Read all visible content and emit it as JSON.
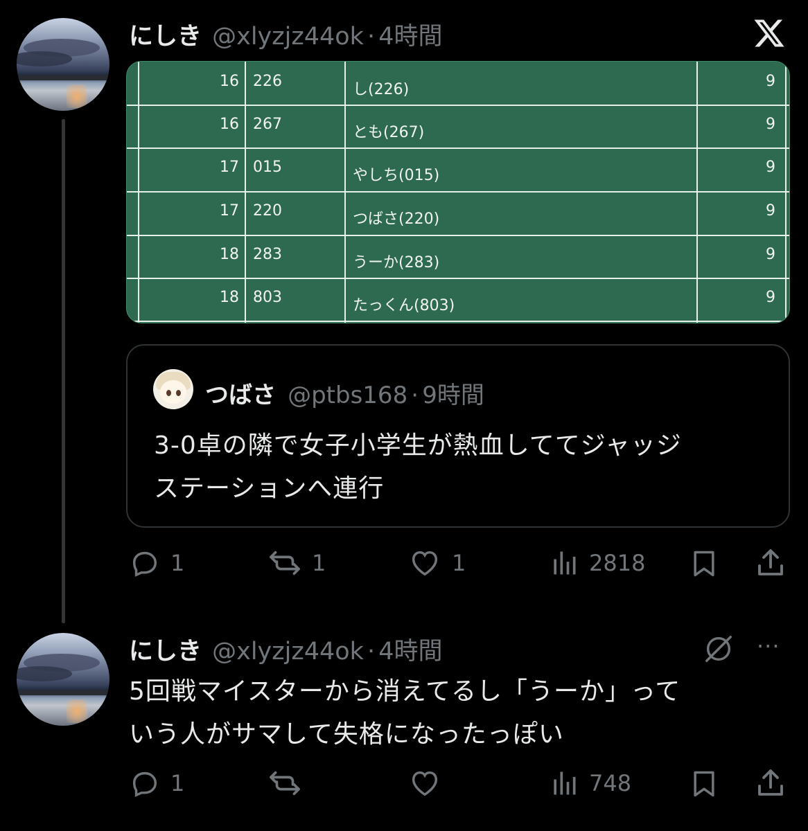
{
  "post1": {
    "display_name": "にしき",
    "handle": "@xlyzjz44ok",
    "separator": "·",
    "time": "4時間",
    "table": {
      "rows": [
        {
          "rank": "16",
          "id": "226",
          "name": "し(226)",
          "score": "9"
        },
        {
          "rank": "16",
          "id": "267",
          "name": "とも(267)",
          "score": "9"
        },
        {
          "rank": "17",
          "id": "015",
          "name": "やしち(015)",
          "score": "9"
        },
        {
          "rank": "17",
          "id": "220",
          "name": "つばさ(220)",
          "score": "9"
        },
        {
          "rank": "18",
          "id": "283",
          "name": "うーか(283)",
          "score": "9"
        },
        {
          "rank": "18",
          "id": "803",
          "name": "たっくん(803)",
          "score": "9"
        }
      ]
    },
    "quote": {
      "display_name": "つばさ",
      "handle": "@ptbs168",
      "separator": "·",
      "time": "9時間",
      "text_line1": "3-0卓の隣で女子小学生が熱血しててジャッジ",
      "text_line2": "ステーションへ連行"
    },
    "actions": {
      "replies": "1",
      "reposts": "1",
      "likes": "1",
      "views": "2818"
    }
  },
  "post2": {
    "display_name": "にしき",
    "handle": "@xlyzjz44ok",
    "separator": "·",
    "time": "4時間",
    "text_line1": "5回戦マイスターから消えてるし「うーか」って",
    "text_line2": "いう人がサマして失格になったっぽい",
    "actions": {
      "replies": "1",
      "views": "748"
    },
    "more": "···"
  },
  "icons": {
    "x_logo": "x-logo-icon",
    "reply": "reply-icon",
    "repost": "repost-icon",
    "like": "heart-icon",
    "views": "views-icon",
    "bookmark": "bookmark-icon",
    "share": "share-icon",
    "grok": "grok-icon"
  },
  "colors": {
    "background": "#000000",
    "text": "#e7e9ea",
    "muted": "#71767b",
    "table_green": "#2d6a4f"
  }
}
